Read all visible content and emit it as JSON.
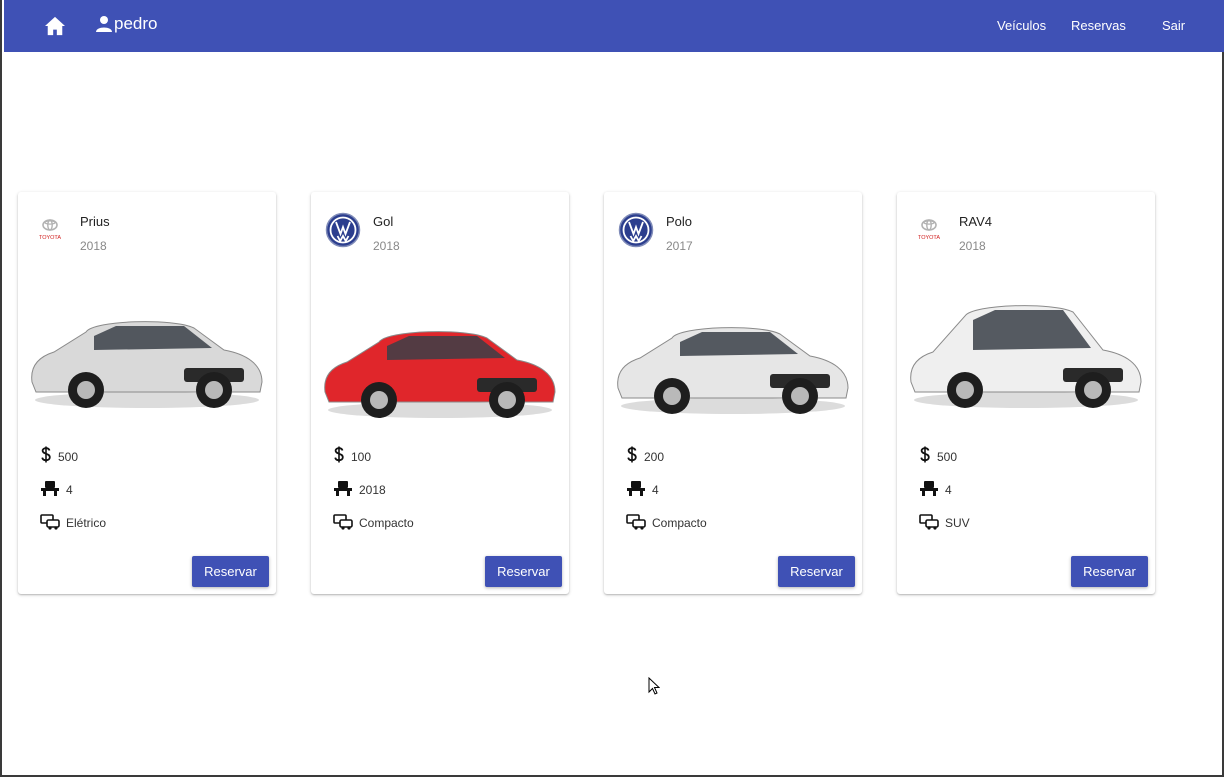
{
  "header": {
    "username": "pedro",
    "nav": {
      "vehicles": "Veículos",
      "reservations": "Reservas",
      "logout": "Sair"
    },
    "color": "#3f51b5"
  },
  "cards": [
    {
      "brand": "toyota",
      "brand_text": "TOYOTA",
      "name": "Prius",
      "year": "2018",
      "price": "500",
      "seats": "4",
      "type": "Elétrico",
      "car_color": "#d9d9d9",
      "button": "Reservar"
    },
    {
      "brand": "volkswagen",
      "brand_text": "VW",
      "name": "Gol",
      "year": "2018",
      "price": "100",
      "seats": "2018",
      "type": "Compacto",
      "car_color": "#e0262b",
      "button": "Reservar"
    },
    {
      "brand": "volkswagen",
      "brand_text": "VW",
      "name": "Polo",
      "year": "2017",
      "price": "200",
      "seats": "4",
      "type": "Compacto",
      "car_color": "#e6e6e6",
      "button": "Reservar"
    },
    {
      "brand": "toyota",
      "brand_text": "TOYOTA",
      "name": "RAV4",
      "year": "2018",
      "price": "500",
      "seats": "4",
      "type": "SUV",
      "car_color": "#efefef",
      "button": "Reservar"
    }
  ]
}
